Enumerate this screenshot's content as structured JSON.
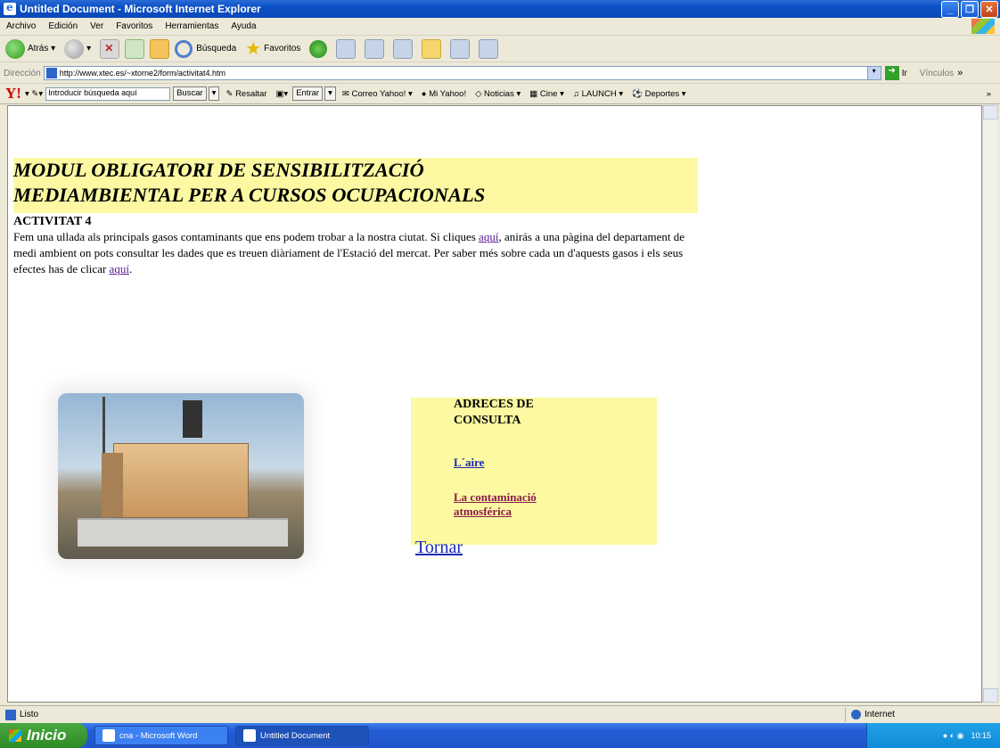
{
  "window": {
    "title": "Untitled Document - Microsoft Internet Explorer"
  },
  "menu": [
    "Archivo",
    "Edición",
    "Ver",
    "Favoritos",
    "Herramientas",
    "Ayuda"
  ],
  "toolbar": {
    "back": "Atrás",
    "search": "Búsqueda",
    "favorites": "Favoritos"
  },
  "address": {
    "label": "Dirección",
    "url": "http://www.xtec.es/~xtorne2/form/activitat4.htm",
    "go": "Ir",
    "links": "Vínculos"
  },
  "yahoo": {
    "search_placeholder": "Introducir búsqueda aquí",
    "search_button": "Buscar",
    "highlight": "Resaltar",
    "enter": "Entrar",
    "items": [
      "Correo Yahoo!",
      "Mi Yahoo!",
      "Noticias",
      "Cine",
      "LAUNCH",
      "Deportes"
    ]
  },
  "page": {
    "title_line1": "MODUL OBLIGATORI DE SENSIBILITZACIÓ",
    "title_line2": "MEDIAMBIENTAL PER A CURSOS OCUPACIONALS",
    "activity": "ACTIVITAT 4",
    "para_part1": "Fem una ullada als principals gasos contaminants que ens podem trobar a la nostra ciutat. Si cliques ",
    "link_here1": "aquí",
    "para_part2": ", anirás a una pàgina del departament de medi ambient on pots consultar les dades que es treuen diàriament de l'Estació del mercat. Per saber més sobre cada un d'aquests gasos i els seus efectes has de clicar ",
    "link_here2": "aquí",
    "para_part3": ".",
    "box_title": "ADRECES DE CONSULTA",
    "link_aire": "L´aire",
    "link_contam": "La contaminació atmosférica",
    "tornar": "Tornar"
  },
  "status": {
    "text": "Listo",
    "zone": "Internet"
  },
  "taskbar": {
    "start": "Inicio",
    "tasks": [
      "cna - Microsoft Word",
      "Untitled Document"
    ],
    "time": "10:15"
  }
}
